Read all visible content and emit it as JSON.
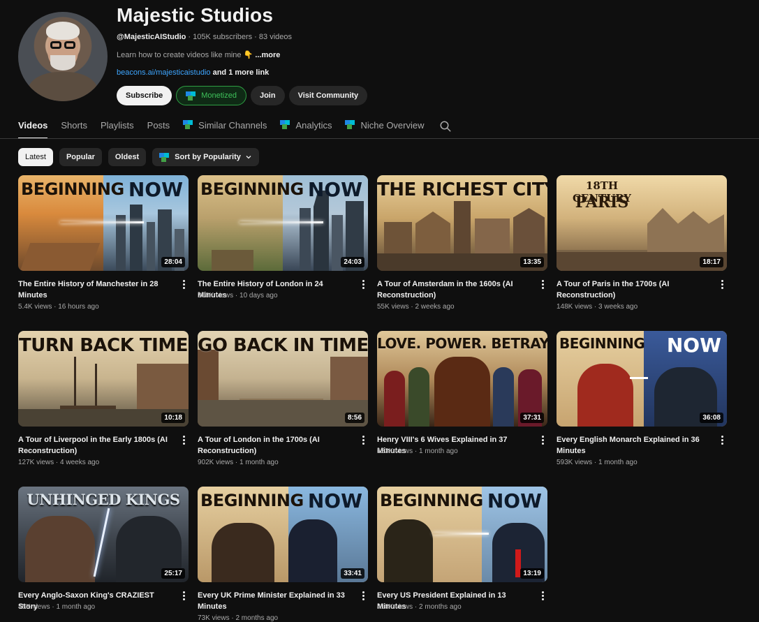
{
  "channel": {
    "name": "Majestic Studios",
    "handle": "@MajesticAIStudio",
    "stats": " · 105K subscribers · 83 videos",
    "description": "Learn how to create videos like mine 👇 ",
    "description_more": "...more",
    "link": "beacons.ai/majesticaistudio",
    "link_more": " and 1 more link"
  },
  "buttons": {
    "subscribe": "Subscribe",
    "monetized": "Monetized",
    "join": "Join",
    "community": "Visit Community"
  },
  "tabs": [
    {
      "label": "Videos",
      "active": true
    },
    {
      "label": "Shorts"
    },
    {
      "label": "Playlists"
    },
    {
      "label": "Posts"
    },
    {
      "label": "Similar Channels",
      "icon": "vidiq-logo-icon"
    },
    {
      "label": "Analytics",
      "icon": "vidiq-logo-icon"
    },
    {
      "label": "Niche Overview",
      "icon": "vidiq-logo-icon"
    }
  ],
  "chips": {
    "latest": "Latest",
    "popular": "Popular",
    "oldest": "Oldest",
    "sort": "Sort by Popularity"
  },
  "videos": [
    {
      "title": "The Entire History of Manchester in 28 Minutes",
      "views": "5.4K views",
      "age": "16 hours ago",
      "duration": "28:04",
      "thumb_left": "BEGINNING",
      "thumb_right": "NOW"
    },
    {
      "title": "The Entire History of London in 24 Minutes",
      "views": "308K views",
      "age": "10 days ago",
      "duration": "24:03",
      "thumb_left": "BEGINNING",
      "thumb_right": "NOW"
    },
    {
      "title": "A Tour of Amsterdam in the 1600s (AI Reconstruction)",
      "views": "55K views",
      "age": "2 weeks ago",
      "duration": "13:35",
      "thumb_text": "THE RICHEST CITY"
    },
    {
      "title": "A Tour of Paris in the 1700s (AI Reconstruction)",
      "views": "148K views",
      "age": "3 weeks ago",
      "duration": "18:17",
      "thumb_text_1": "18TH CENTURY",
      "thumb_text_2": "PARIS"
    },
    {
      "title": "A Tour of Liverpool in the Early 1800s (AI Reconstruction)",
      "views": "127K views",
      "age": "4 weeks ago",
      "duration": "10:18",
      "thumb_text": "TURN BACK TIME"
    },
    {
      "title": "A Tour of London in the 1700s (AI Reconstruction)",
      "views": "902K views",
      "age": "1 month ago",
      "duration": "8:56",
      "thumb_text": "GO BACK IN TIME"
    },
    {
      "title": "Henry VIII's 6 Wives Explained in 37 Minutes",
      "views": "123K views",
      "age": "1 month ago",
      "duration": "37:31",
      "thumb_text": "LOVE. POWER. BETRAYAL."
    },
    {
      "title": "Every English Monarch Explained in 36 Minutes",
      "views": "593K views",
      "age": "1 month ago",
      "duration": "36:08",
      "thumb_left": "BEGINNING",
      "thumb_right": "NOW"
    },
    {
      "title": "Every Anglo-Saxon King's CRAZIEST Story",
      "views": "45K views",
      "age": "1 month ago",
      "duration": "25:17",
      "thumb_text": "UNHINGED KINGS"
    },
    {
      "title": "Every UK Prime Minister Explained in 33 Minutes",
      "views": "73K views",
      "age": "2 months ago",
      "duration": "33:41",
      "thumb_left": "BEGINNING",
      "thumb_right": "NOW"
    },
    {
      "title": "Every US President Explained in 13 Minutes",
      "views": "418K views",
      "age": "2 months ago",
      "duration": "13:19",
      "thumb_left": "BEGINNING",
      "thumb_right": "NOW"
    }
  ],
  "colors": {
    "background": "#0f0f0f",
    "link": "#3ea6ff",
    "monetized": "#3ec15a"
  }
}
